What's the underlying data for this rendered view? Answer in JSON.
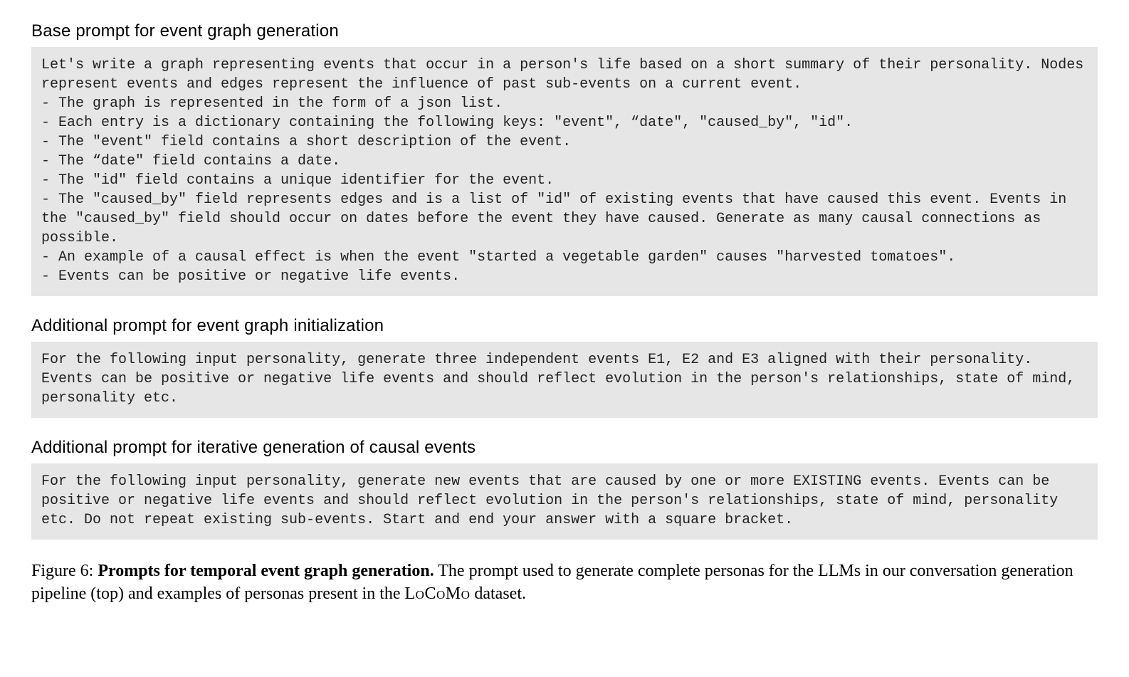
{
  "sections": [
    {
      "heading": "Base prompt for event graph generation",
      "body": "Let's write a graph representing events that occur in a person's life based on a short summary of their personality. Nodes represent events and edges represent the influence of past sub-events on a current event.\n- The graph is represented in the form of a json list.\n- Each entry is a dictionary containing the following keys: \"event\", “date\", \"caused_by\", \"id\".\n- The \"event\" field contains a short description of the event.\n- The “date\" field contains a date.\n- The \"id\" field contains a unique identifier for the event.\n- The \"caused_by\" field represents edges and is a list of \"id\" of existing events that have caused this event. Events in the \"caused_by\" field should occur on dates before the event they have caused. Generate as many causal connections as possible.\n- An example of a causal effect is when the event \"started a vegetable garden\" causes \"harvested tomatoes\".\n- Events can be positive or negative life events."
    },
    {
      "heading": "Additional prompt for event graph initialization",
      "body": "For the following input personality, generate three independent events E1, E2 and E3 aligned with their personality. Events can be positive or negative life events and should reflect evolution in the person's relationships, state of mind, personality etc."
    },
    {
      "heading": "Additional prompt for iterative generation of causal events",
      "body": "For the following input personality, generate new events that are caused by one or more EXISTING events. Events can be positive or negative life events and should reflect evolution in the person's relationships, state of mind, personality etc. Do not repeat existing sub-events. Start and end your answer with a square bracket."
    }
  ],
  "caption": {
    "label": "Figure 6:",
    "title": "Prompts for temporal event graph generation.",
    "rest_pre": " The prompt used to generate complete personas for the LLMs in our conversation generation pipeline (top) and examples of personas present in the ",
    "dataset_name": "LoCoMo",
    "rest_post": " dataset."
  }
}
